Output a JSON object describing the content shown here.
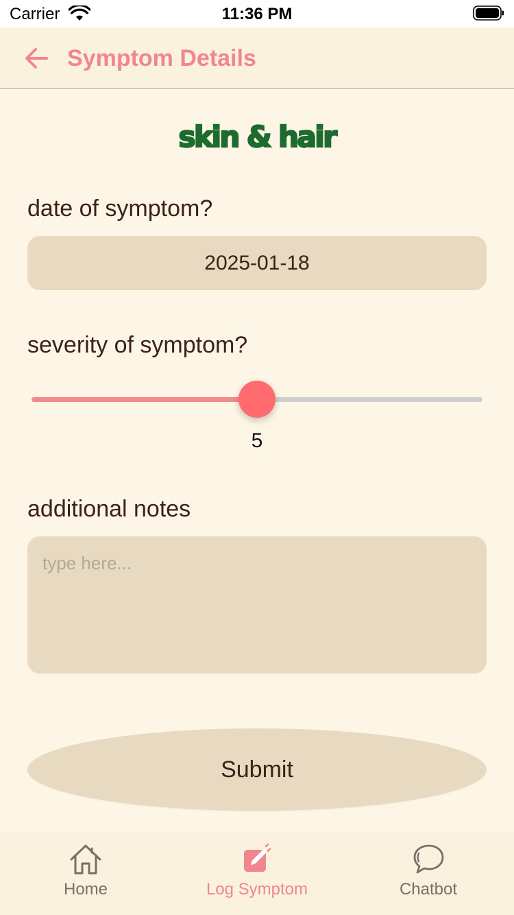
{
  "status_bar": {
    "carrier": "Carrier",
    "time": "11:36 PM"
  },
  "header": {
    "title": "Symptom Details"
  },
  "logo": {
    "text": "skin & hair",
    "color": "#1e6b2e"
  },
  "form": {
    "date_label": "date of symptom?",
    "date_value": "2025-01-18",
    "severity_label": "severity of symptom?",
    "severity_value": "5",
    "severity_min": 0,
    "severity_max": 10,
    "notes_label": "additional notes",
    "notes_placeholder": "type here...",
    "notes_value": "",
    "submit_label": "Submit"
  },
  "tabs": [
    {
      "label": "Home",
      "icon": "home-icon",
      "active": false
    },
    {
      "label": "Log Symptom",
      "icon": "edit-icon",
      "active": true
    },
    {
      "label": "Chatbot",
      "icon": "chat-icon",
      "active": false
    }
  ],
  "colors": {
    "accent": "#f0868e",
    "slider_fill": "#f58a8e",
    "slider_thumb": "#ff6b6f",
    "background": "#fdf6e6",
    "field": "#e8dac0",
    "text": "#3b2219"
  }
}
